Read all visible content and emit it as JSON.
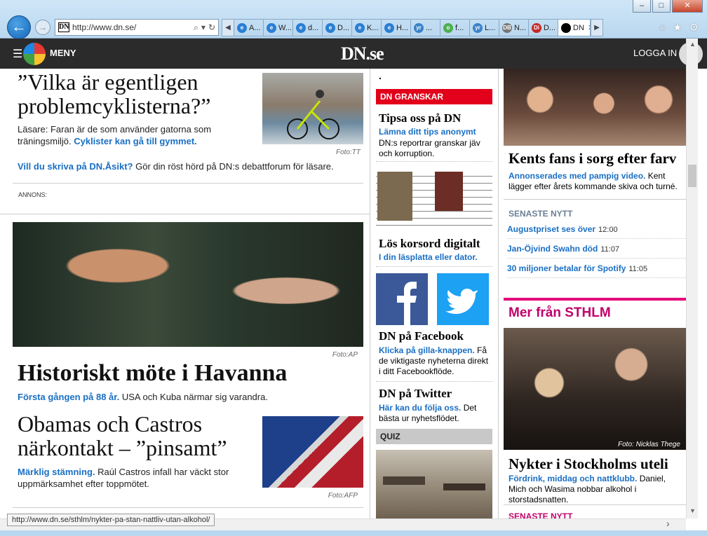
{
  "browser": {
    "address_url": "http://www.dn.se/",
    "dn_favicon": "DN",
    "tabs": [
      {
        "label": "A...",
        "fav": "e",
        "color": "#2a7fd4"
      },
      {
        "label": "W...",
        "fav": "e",
        "color": "#2a7fd4"
      },
      {
        "label": "d...",
        "fav": "e",
        "color": "#2a7fd4"
      },
      {
        "label": "D...",
        "fav": "e",
        "color": "#2a7fd4"
      },
      {
        "label": "K...",
        "fav": "e",
        "color": "#2a7fd4"
      },
      {
        "label": "H...",
        "fav": "e",
        "color": "#2a7fd4"
      },
      {
        "label": "...",
        "fav": "yr",
        "color": "#3a83c8"
      },
      {
        "label": "f...",
        "fav": "o",
        "color": "#4caf50"
      },
      {
        "label": "L...",
        "fav": "yr",
        "color": "#3a83c8"
      },
      {
        "label": "N...",
        "fav": "DB",
        "color": "#777"
      },
      {
        "label": "D...",
        "fav": "Di",
        "color": "#c62828"
      },
      {
        "label": "DN",
        "fav": "",
        "color": "#000"
      }
    ],
    "status_url": "http://www.dn.se/sthlm/nykter-pa-stan-nattliv-utan-alkohol/"
  },
  "header": {
    "menu_label": "MENY",
    "brand": "DN.se",
    "login": "LOGGA IN"
  },
  "left": {
    "story1": {
      "headline": "”Vilka är egentligen problemcyklisterna?”",
      "dek_text": "Läsare: Faran är de som använder gatorna som träningsmiljö.",
      "dek_link": "Cyklister kan gå till gymmet.",
      "caption": "Foto:TT"
    },
    "opinion": {
      "link": "Vill du skriva på DN.Åsikt?",
      "text": "Gör din röst hörd på DN:s debattforum för läsare."
    },
    "ad_label": "ANNONS:",
    "main": {
      "caption": "Foto:AP",
      "headline": "Historiskt möte i Havanna",
      "lead": "Första gången på 88 år.",
      "text": "USA och Kuba närmar sig varandra."
    },
    "story3": {
      "headline": "Obamas och Castros närkontakt – ”pinsamt”",
      "lead": "Märklig stämning.",
      "text": "Raúl Castros infall har väckt stor uppmärksamhet efter toppmötet.",
      "caption": "Foto:AFP"
    }
  },
  "mid": {
    "dot": ".",
    "granskar_label": "DN GRANSKAR",
    "tips_title": "Tipsa oss på DN",
    "tips_link": "Lämna ditt tips anonymt",
    "tips_text": "DN:s reportrar granskar jäv och korruption.",
    "cross_title": "Lös korsord digitalt",
    "cross_link": "I din läsplatta eller dator.",
    "fb_title": "DN på Facebook",
    "fb_link": "Klicka på gilla-knappen.",
    "fb_text": "Få de viktigaste nyheterna direkt i ditt Facebookflöde.",
    "tw_title": "DN på Twitter",
    "tw_link": "Här kan du följa oss.",
    "tw_text": "Det bästa ur nyhetsflödet.",
    "quiz_label": "QUIZ"
  },
  "right": {
    "kent_headline": "Kents fans i sorg efter farv",
    "kent_lead": "Annonserades med pampig video.",
    "kent_text": "Kent lägger efter årets kommande skiva och turné.",
    "latest_label": "SENASTE NYTT",
    "latest": [
      {
        "title": "Augustpriset ses över",
        "time": "12:00"
      },
      {
        "title": "Jan-Öjvind Swahn död",
        "time": "11:07"
      },
      {
        "title": "30 miljoner betalar för Spotify",
        "time": "11:05"
      }
    ],
    "sthlm_label": "Mer från STHLM",
    "sthlm_caption": "Foto: Nicklas Thege",
    "sthlm_headline": "Nykter i Stockholms uteli",
    "sthlm_lead": "Fördrink, middag och nattklubb.",
    "sthlm_text": "Daniel, Mich och Wasima nobbar alkohol i storstadsnatten.",
    "latest_label_2": "SENASTE NYTT"
  }
}
